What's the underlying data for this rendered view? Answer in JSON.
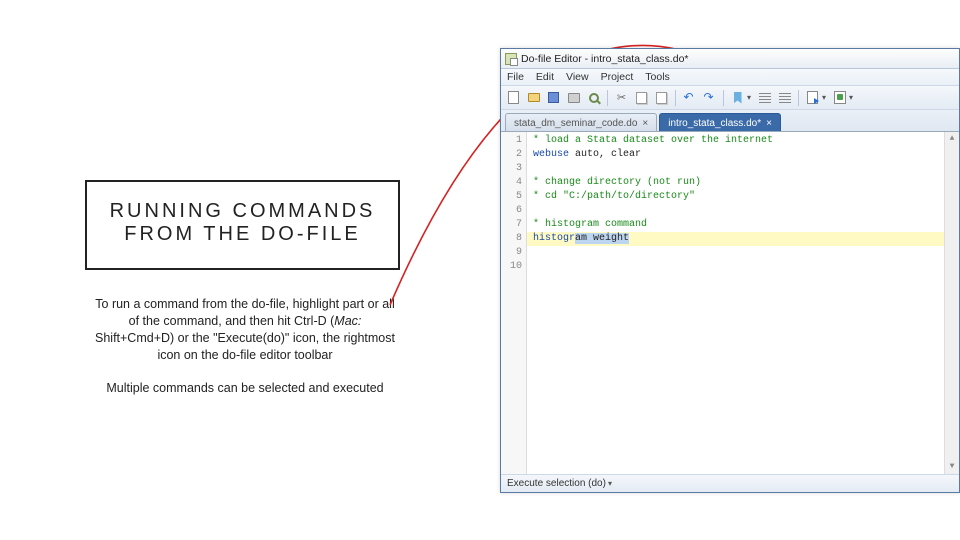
{
  "title": "RUNNING COMMANDS FROM THE DO-FILE",
  "para1_a": "To run a command from the do-file, highlight part or all of the command, and then hit Ctrl-D (",
  "para1_b": "Mac:",
  "para1_c": " Shift+Cmd+D) or the \"Execute(do)\" icon, the rightmost icon on the do-file editor toolbar",
  "para2": "Multiple commands can be selected and executed",
  "editor": {
    "window_title": "Do-file Editor - intro_stata_class.do*",
    "menu": [
      "File",
      "Edit",
      "View",
      "Project",
      "Tools"
    ],
    "tabs": [
      {
        "label": "stata_dm_seminar_code.do",
        "active": false
      },
      {
        "label": "intro_stata_class.do*",
        "active": true
      }
    ],
    "gutter": [
      "1",
      "2",
      "3",
      "4",
      "5",
      "6",
      "7",
      "8",
      "9",
      "10"
    ],
    "code": {
      "l1": "* load a Stata dataset over the internet",
      "l2a": "webuse",
      "l2b": " auto, clear",
      "l3": "",
      "l4": "* change directory (not run)",
      "l5a": "* cd ",
      "l5b": "\"C:/path/to/directory\"",
      "l6": "",
      "l7": "* histogram command",
      "l8a": "histogr",
      "l8b": "am weight",
      "l9": "",
      "l10": ""
    },
    "statusbar": "Execute selection (do)"
  }
}
